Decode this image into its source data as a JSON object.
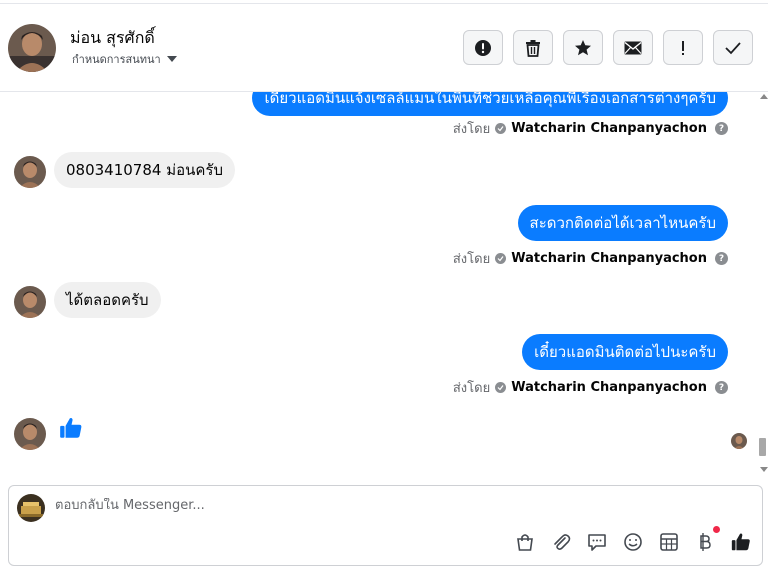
{
  "header": {
    "name": "ม่อน สุรศักดิ์",
    "subtitle": "กำหนดการสนทนา"
  },
  "messages": [
    {
      "dir": "out",
      "text": "เดี๋ยวแอดมินแจ้งเซลล์แมนในพื้นที่ช่วยเหลือคุณพี่เรื่องเอกสารต่างๆครับ",
      "partial": true
    },
    {
      "dir": "in",
      "text": "0803410784 ม่อนครับ"
    },
    {
      "dir": "out",
      "text": "สะดวกติดต่อได้เวลาไหนครับ"
    },
    {
      "dir": "in",
      "text": "ได้ตลอดครับ"
    },
    {
      "dir": "out",
      "text": "เดี๋ยวแอดมินติดต่อไปนะครับ"
    }
  ],
  "sent_by": {
    "prefix": "ส่งโดย",
    "name": "Watcharin Chanpanyachon"
  },
  "composer": {
    "placeholder": "ตอบกลับใน Messenger..."
  },
  "colors": {
    "outgoing_bubble": "#0a7cff",
    "incoming_bubble": "#f0f0f0",
    "like": "#0a7cff"
  },
  "icons": [
    "report-icon",
    "trash-icon",
    "star-icon",
    "envelope-icon",
    "exclamation-icon",
    "check-icon",
    "shopping-bag-icon",
    "paperclip-icon",
    "chat-bubble-icon",
    "emoji-icon",
    "table-icon",
    "baht-icon",
    "like-icon"
  ]
}
